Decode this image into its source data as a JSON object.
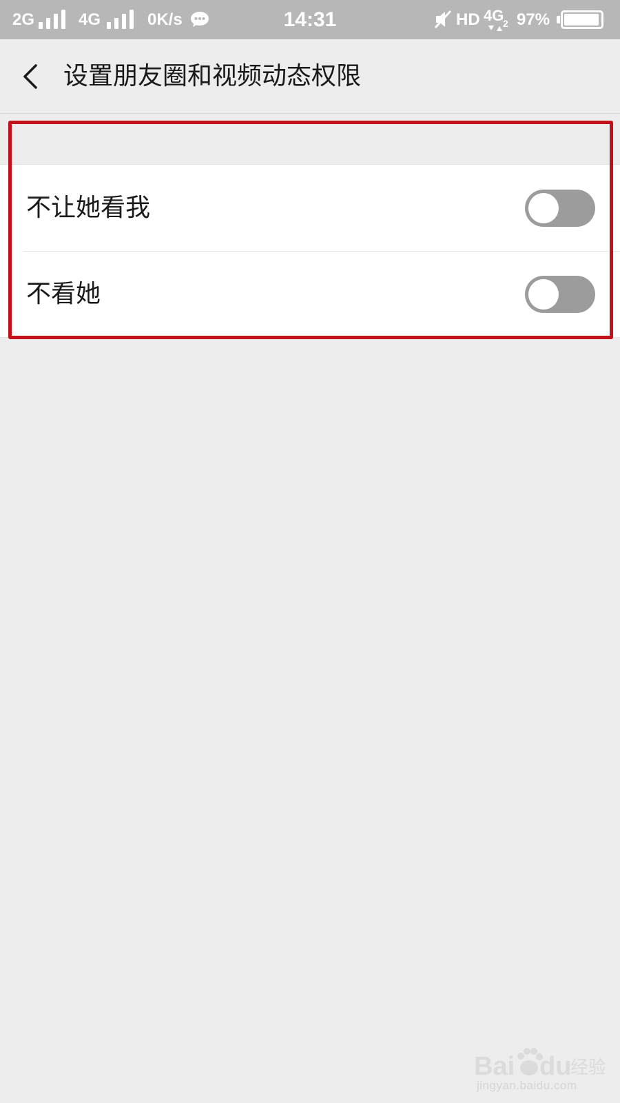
{
  "status_bar": {
    "network_1": "2G",
    "network_2": "4G",
    "speed": "0K/s",
    "time": "14:31",
    "hd": "HD",
    "network_3": "4G",
    "network_3_sub": "2",
    "battery_text": "97%",
    "battery_level": 0.97
  },
  "header": {
    "title": "设置朋友圈和视频动态权限",
    "back_icon": "chevron-left-icon"
  },
  "settings": {
    "items": [
      {
        "label": "不让她看我",
        "toggle_on": false
      },
      {
        "label": "不看她",
        "toggle_on": false
      }
    ]
  },
  "watermark": {
    "brand": "Bai du 经验",
    "url": "jingyan.baidu.com"
  },
  "colors": {
    "status_bar_bg": "#b7b7b7",
    "page_bg": "#ededed",
    "toggle_off": "#9c9c9c",
    "highlight": "#c2111b"
  }
}
